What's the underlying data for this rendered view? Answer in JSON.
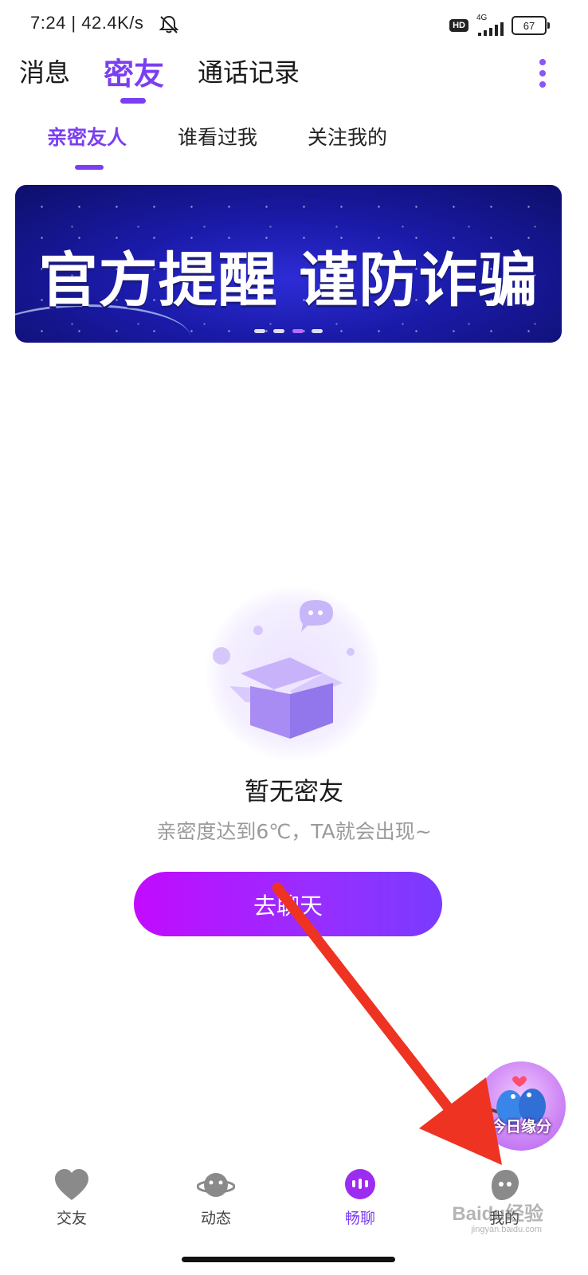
{
  "status_bar": {
    "time_speed": "7:24 | 42.4K/s",
    "hd": "HD",
    "network": "4G",
    "battery": "67"
  },
  "top_tabs": [
    {
      "label": "消息"
    },
    {
      "label": "密友"
    },
    {
      "label": "通话记录"
    }
  ],
  "sub_tabs": [
    {
      "label": "亲密友人"
    },
    {
      "label": "谁看过我"
    },
    {
      "label": "关注我的"
    }
  ],
  "banner": {
    "text": "官方提醒 谨防诈骗",
    "active_dot_index": 2
  },
  "empty_state": {
    "title": "暂无密友",
    "subtitle": "亲密度达到6℃，TA就会出现~",
    "button_label": "去聊天"
  },
  "fate_widget": {
    "label": "今日缘分"
  },
  "bottom_nav": [
    {
      "label": "交友",
      "icon": "heart-icon"
    },
    {
      "label": "动态",
      "icon": "planet-icon"
    },
    {
      "label": "畅聊",
      "icon": "chat-bubble-icon"
    },
    {
      "label": "我的",
      "icon": "profile-ghost-icon"
    }
  ],
  "watermark": {
    "text": "Baidu经验",
    "sub": "jingyan.baidu.com"
  },
  "colors": {
    "accent": "#7b3ff2",
    "button_gradient_start": "#c20aff",
    "button_gradient_end": "#7a3bff",
    "annotation_arrow": "#ee3322"
  }
}
